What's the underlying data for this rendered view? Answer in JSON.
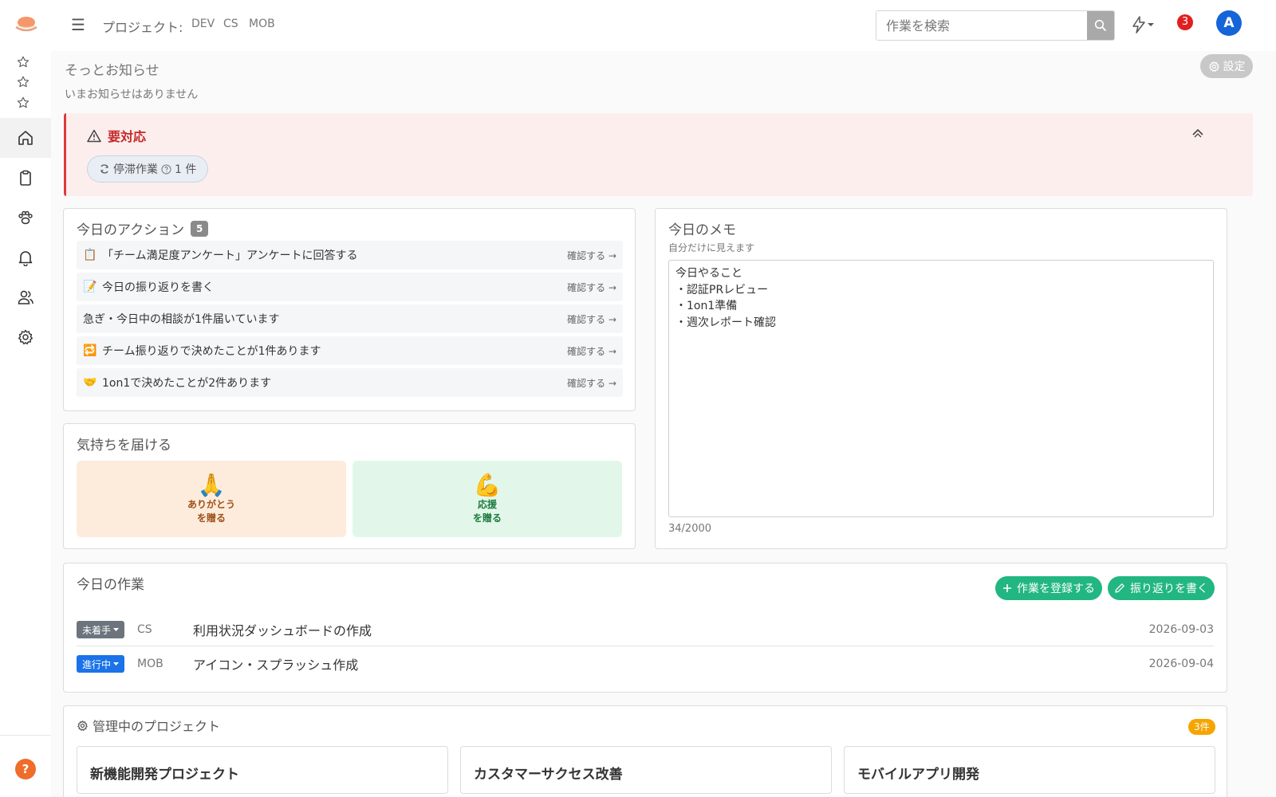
{
  "header": {
    "project_label": "プロジェクト:",
    "projects": [
      "DEV",
      "CS",
      "MOB"
    ],
    "search_placeholder": "作業を検索",
    "notification_count": "3",
    "avatar_initial": "A"
  },
  "announcement": {
    "title": "そっとお知らせ",
    "empty_text": "いまお知らせはありません",
    "settings_label": "設定"
  },
  "alert": {
    "title": "要対応",
    "stale_label": "停滞作業",
    "stale_count": "1 件"
  },
  "actions": {
    "title": "今日のアクション",
    "count": "5",
    "confirm_label": "確認する →",
    "items": [
      {
        "emoji": "📋",
        "text": "「チーム満足度アンケート」アンケートに回答する"
      },
      {
        "emoji": "📝",
        "text": "今日の振り返りを書く"
      },
      {
        "emoji": "",
        "text": "急ぎ・今日中の相談が1件届いています"
      },
      {
        "emoji": "🔁",
        "text": "チーム振り返りで決めたことが1件あります"
      },
      {
        "emoji": "🤝",
        "text": "1on1で決めたことが2件あります"
      }
    ]
  },
  "gifts": {
    "title": "気持ちを届ける",
    "thanks": {
      "emoji": "🙏",
      "line1": "ありがとう",
      "line2": "を贈る"
    },
    "cheer": {
      "emoji": "💪",
      "line1": "応援",
      "line2": "を贈る"
    }
  },
  "memo": {
    "title": "今日のメモ",
    "subtitle": "自分だけに見えます",
    "content": "今日やること\n・認証PRレビュー\n・1on1準備\n・週次レポート確認",
    "counter": "34/2000"
  },
  "tasks": {
    "title": "今日の作業",
    "register_label": "作業を登録する",
    "reflect_label": "振り返りを書く",
    "rows": [
      {
        "status": "未着手",
        "status_color": "#6c757d",
        "project": "CS",
        "title": "利用状況ダッシュボードの作成",
        "date": "2026-09-03"
      },
      {
        "status": "進行中",
        "status_color": "#1a73e8",
        "project": "MOB",
        "title": "アイコン・スプラッシュ作成",
        "date": "2026-09-04"
      }
    ]
  },
  "managed": {
    "title": "管理中のプロジェクト",
    "count": "3件",
    "projects": [
      "新機能開発プロジェクト",
      "カスタマーサクセス改善",
      "モバイルアプリ開発"
    ]
  },
  "colors": {
    "accent_green": "#22b683",
    "alert_red": "#c62828",
    "brand_blue": "#1565d8",
    "badge_orange": "#f5a500"
  }
}
